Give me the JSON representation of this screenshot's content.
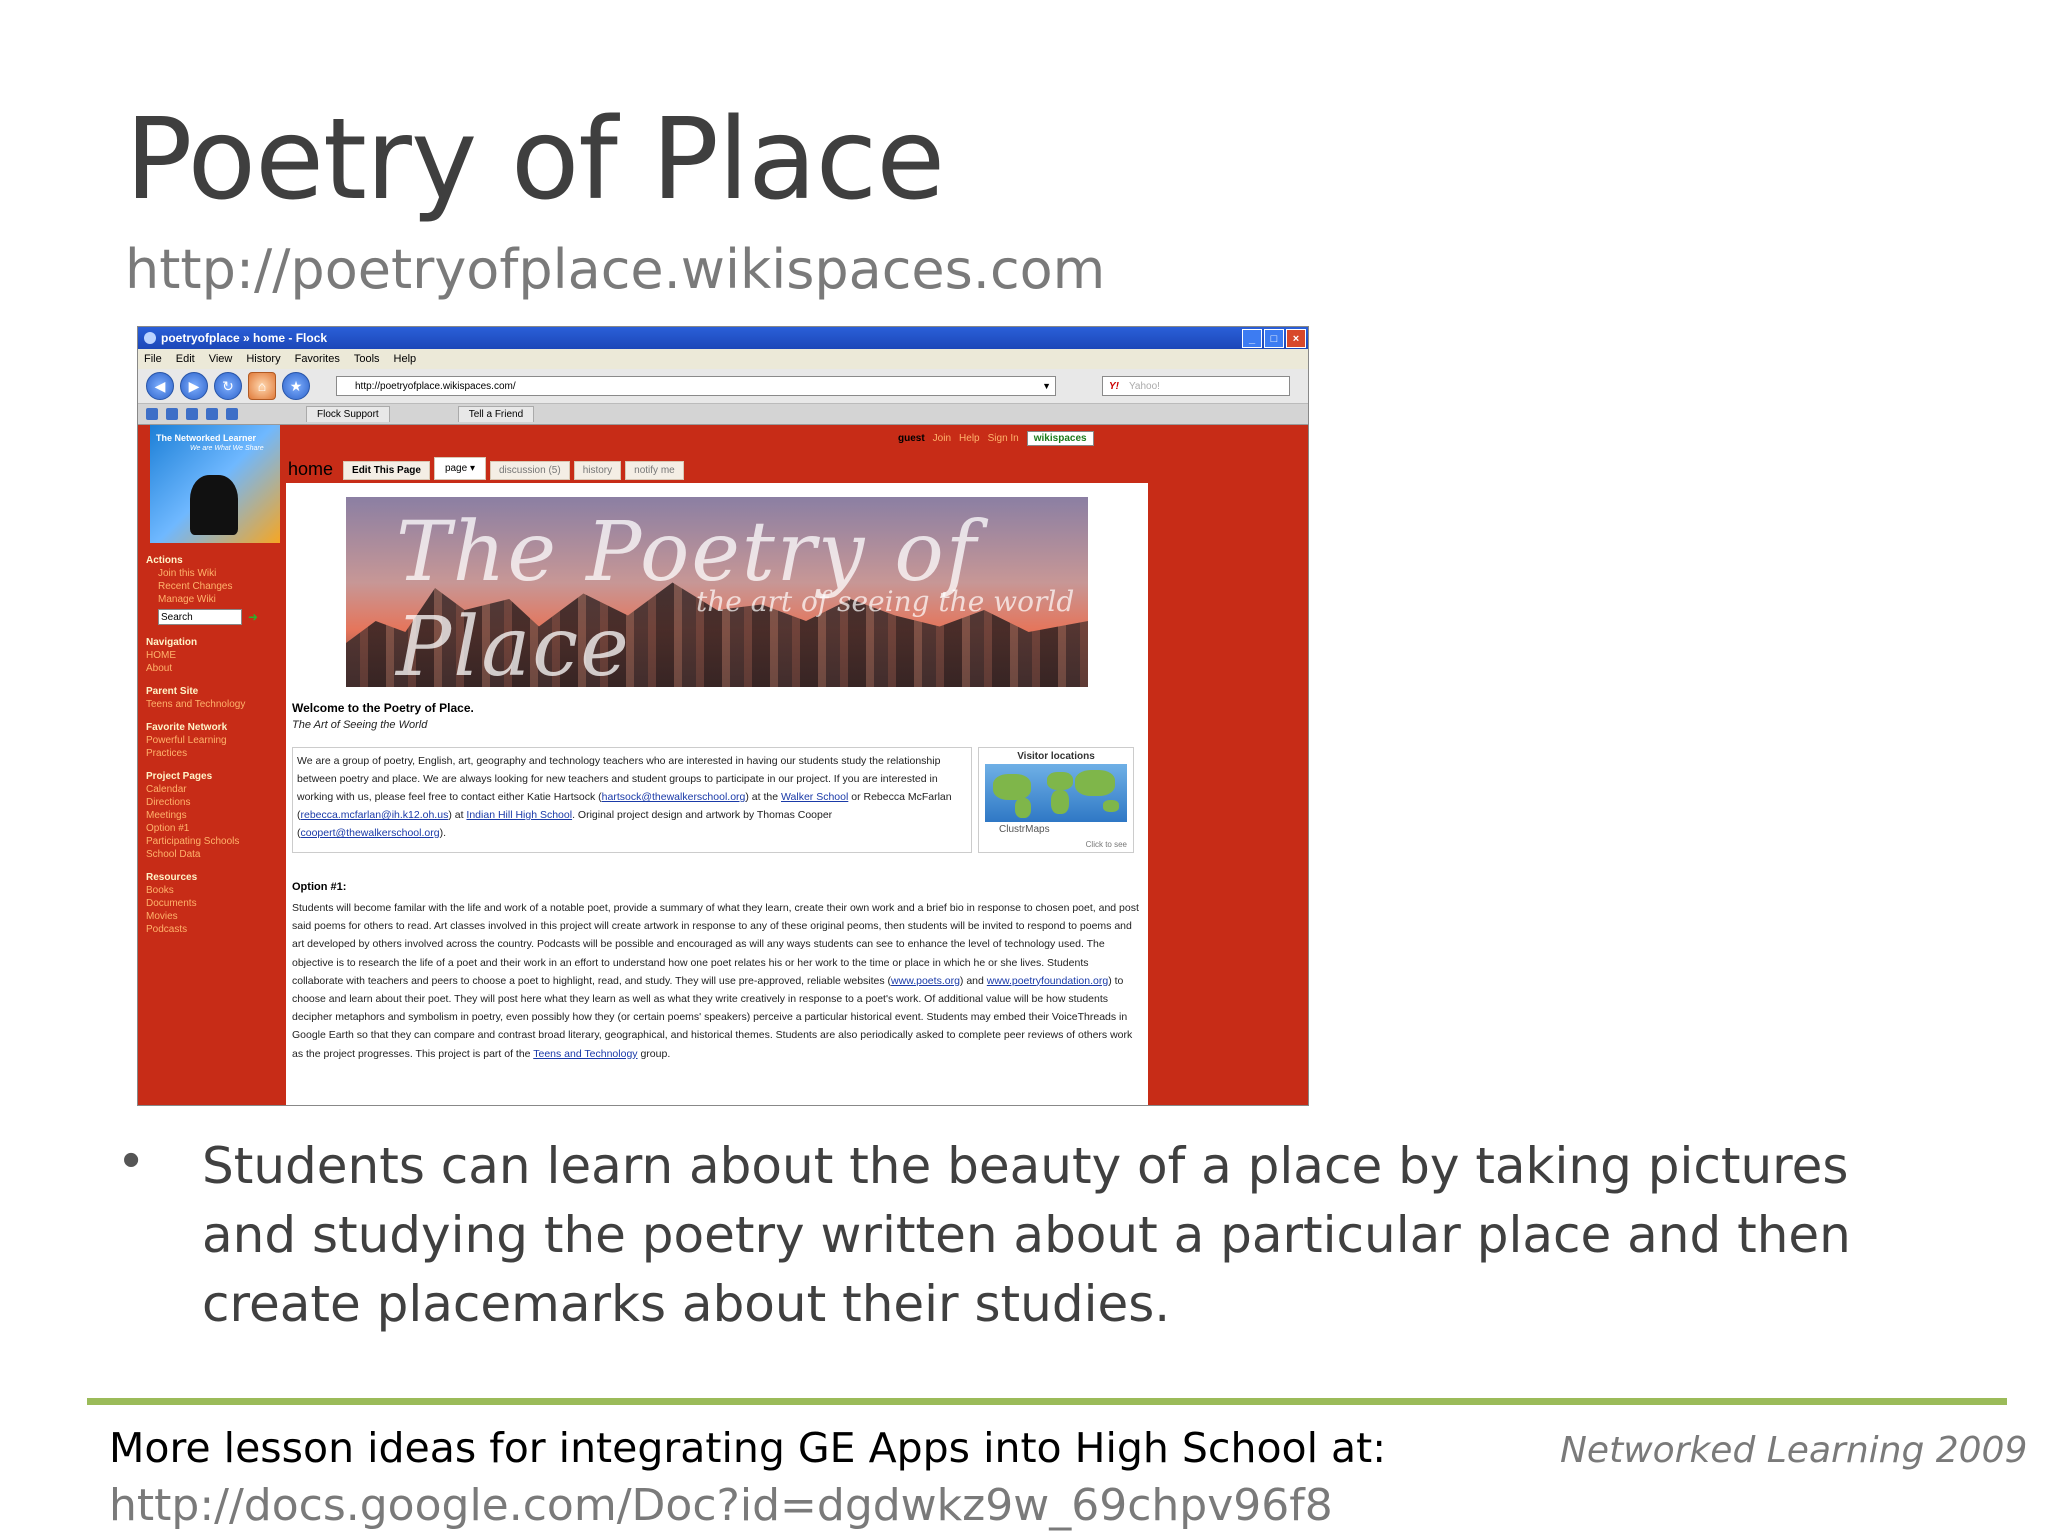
{
  "slide": {
    "title": "Poetry of Place",
    "subtitle": "http://poetryofplace.wikispaces.com",
    "bullet": "Students can learn about the beauty of a place by taking pictures and studying the poetry written about a particular place and then create placemarks about their studies.",
    "footer_text": "More lesson ideas for integrating GE Apps into High School at:",
    "footer_url": "http://docs.google.com/Doc?id=dgdwkz9w_69chpv96f8",
    "footer_credit": "Networked Learning 2009",
    "accent_color": "#9bbb59"
  },
  "browser": {
    "window_title": "poetryofplace » home - Flock",
    "menu": [
      "File",
      "Edit",
      "View",
      "History",
      "Favorites",
      "Tools",
      "Help"
    ],
    "url": "http://poetryofplace.wikispaces.com/",
    "search_placeholder": "Yahoo!",
    "bookmarks": [
      "Flock Support",
      "Tell a Friend"
    ]
  },
  "wiki": {
    "top_nav": {
      "guest": "guest",
      "join": "Join",
      "help": "Help",
      "sign_in": "Sign In",
      "brand": "wikispaces"
    },
    "home_label": "home",
    "tabs": {
      "edit": "Edit This Page",
      "page": "page ▾",
      "discussion": "discussion (5)",
      "history": "history",
      "notify": "notify me"
    },
    "logo": {
      "text": "The Networked Learner",
      "sub": "We are What We Share"
    },
    "sidebar": {
      "actions_h": "Actions",
      "actions": [
        "Join this Wiki",
        "Recent Changes",
        "Manage Wiki"
      ],
      "search_value": "Search",
      "navigation_h": "Navigation",
      "navigation": [
        "HOME",
        "About"
      ],
      "parent_h": "Parent Site",
      "parent": [
        "Teens and Technology"
      ],
      "favorite_h": "Favorite Network",
      "favorite": [
        "Powerful Learning",
        "Practices"
      ],
      "project_h": "Project Pages",
      "project": [
        "Calendar",
        "Directions",
        "Meetings",
        "Option #1",
        "Participating Schools",
        "School Data"
      ],
      "resources_h": "Resources",
      "resources": [
        "Books",
        "Documents",
        "Movies",
        "Podcasts"
      ]
    },
    "banner": {
      "title": "The Poetry of Place",
      "sub": "the art of seeing the world"
    },
    "welcome": "Welcome to the Poetry of Place.",
    "tagline": "The Art of Seeing the World",
    "intro": {
      "p1": "We are a group of poetry, English, art, geography and technology teachers who are interested in having our students study the relationship between poetry and place. We are always looking for new teachers and student groups to participate in our project. If you are interested in working with us, please feel free to contact either Katie Hartsock (",
      "email1": "hartsock@thewalkerschool.org",
      "p2": ") at the ",
      "school1": "Walker School",
      "p3": " or Rebecca McFarlan (",
      "email2": "rebecca.mcfarlan@ih.k12.oh.us",
      "p4": ") at ",
      "school2": "Indian Hill High School",
      "p5": ". Original project design and artwork by Thomas Cooper (",
      "email3": "coopert@thewalkerschool.org",
      "p6": ")."
    },
    "visitor": {
      "heading": "Visitor locations",
      "brand": "ClustrMaps",
      "click": "Click to see"
    },
    "option_h": "Option #1:",
    "option": {
      "p1": "Students will become familar with the life and work of a notable poet, provide a summary of what they learn, create their own work and a brief bio in response to chosen poet, and post said poems for others to read. Art classes involved in this project will create artwork in response to any of these original peoms, then students will be invited to respond to poems and art developed by others involved across the country. Podcasts will be possible and encouraged as will any ways students can see to enhance the level of technology used. The objective is to research the life of a poet and their work in an effort to understand how one poet relates his or her work to the time or place in which he or she lives. Students collaborate with teachers and peers to choose a poet to highlight, read, and study. They will use pre-approved, reliable websites (",
      "link1": "www.poets.org",
      "p2": ") and ",
      "link2": "www.poetryfoundation.org",
      "p3": ") to choose and learn about their poet. They will post here what they learn as well as what they write creatively in response to a poet's work. Of additional value will be how students decipher metaphors and symbolism in poetry, even possibly how they (or certain poems' speakers) perceive a particular historical event. Students may embed their VoiceThreads in Google Earth so that they can compare and contrast broad literary, geographical, and historical themes. Students are also periodically asked to complete peer reviews of others work as the project progresses. This project is part of the ",
      "link3": "Teens and Technology",
      "p4": " group."
    }
  }
}
